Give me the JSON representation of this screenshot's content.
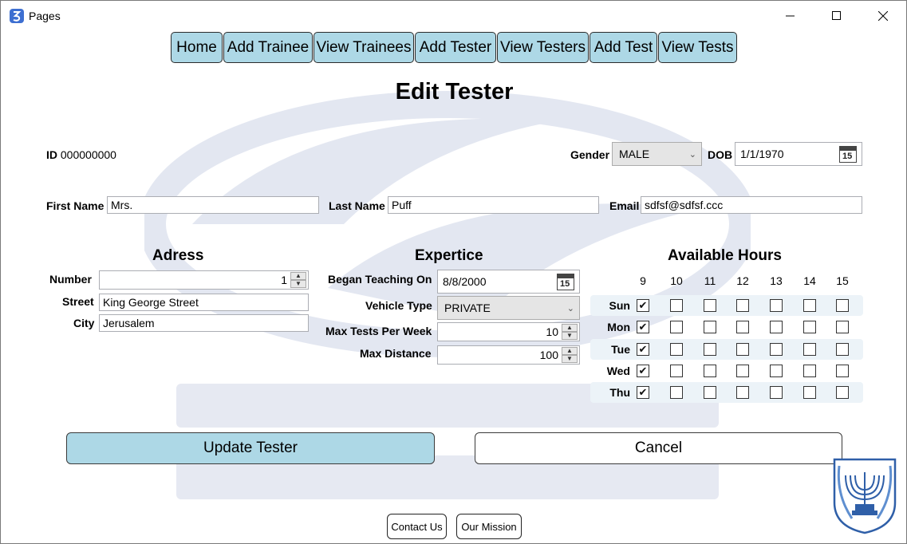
{
  "window": {
    "title": "Pages"
  },
  "nav": [
    "Home",
    "Add Trainee",
    "View Trainees",
    "Add Tester",
    "View Testers",
    "Add Test",
    "View Tests"
  ],
  "page_title": "Edit Tester",
  "tester": {
    "id_label": "ID",
    "id_value": "000000000",
    "gender_label": "Gender",
    "gender_value": "MALE",
    "dob_label": "DOB",
    "dob_value": "1/1/1970",
    "first_name_label": "First Name",
    "first_name_value": "Mrs.",
    "last_name_label": "Last Name",
    "last_name_value": "Puff",
    "email_label": "Email",
    "email_value": "sdfsf@sdfsf.ccc"
  },
  "address": {
    "title": "Adress",
    "number_label": "Number",
    "number_value": "1",
    "street_label": "Street",
    "street_value": "King George Street",
    "city_label": "City",
    "city_value": "Jerusalem"
  },
  "expertise": {
    "title": "Expertice",
    "began_label": "Began Teaching On",
    "began_value": "8/8/2000",
    "vehicle_label": "Vehicle Type",
    "vehicle_value": "PRIVATE",
    "max_tests_label": "Max Tests Per Week",
    "max_tests_value": "10",
    "max_distance_label": "Max Distance",
    "max_distance_value": "100"
  },
  "hours": {
    "title": "Available Hours",
    "columns": [
      "9",
      "10",
      "11",
      "12",
      "13",
      "14",
      "15"
    ],
    "days": [
      {
        "label": "Sun",
        "checked": [
          true,
          false,
          false,
          false,
          false,
          false,
          false
        ]
      },
      {
        "label": "Mon",
        "checked": [
          true,
          false,
          false,
          false,
          false,
          false,
          false
        ]
      },
      {
        "label": "Tue",
        "checked": [
          true,
          false,
          false,
          false,
          false,
          false,
          false
        ]
      },
      {
        "label": "Wed",
        "checked": [
          true,
          false,
          false,
          false,
          false,
          false,
          false
        ]
      },
      {
        "label": "Thu",
        "checked": [
          true,
          false,
          false,
          false,
          false,
          false,
          false
        ]
      }
    ]
  },
  "actions": {
    "update": "Update Tester",
    "cancel": "Cancel"
  },
  "footer": {
    "contact": "Contact Us",
    "mission": "Our Mission"
  },
  "colors": {
    "accent": "#add8e6",
    "border": "#2b2b2b",
    "watermark": "#dfe3ef"
  }
}
